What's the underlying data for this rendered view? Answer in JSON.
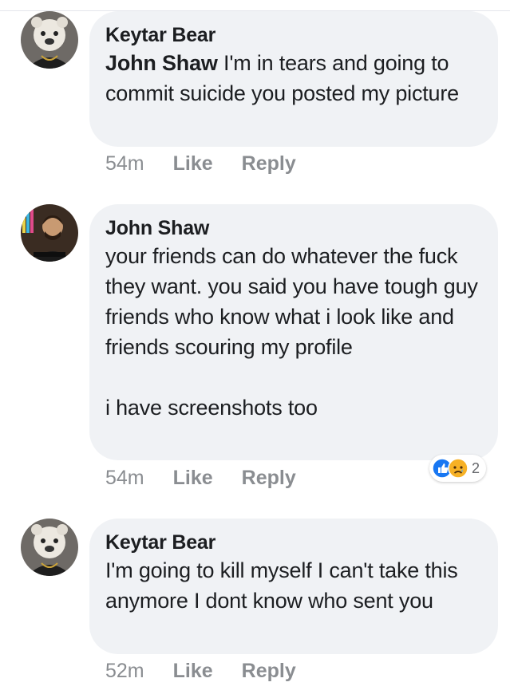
{
  "comments": [
    {
      "author": "Keytar Bear",
      "mention": "John Shaw",
      "text": "I'm in tears and going to commit suicide you posted my picture",
      "time": "54m",
      "like": "Like",
      "reply": "Reply"
    },
    {
      "author": "John Shaw",
      "text": "your friends can do whatever the fuck they want. you said you have tough guy friends who know what i look like and friends scouring my profile",
      "text2": "i have screenshots too",
      "time": "54m",
      "like": "Like",
      "reply": "Reply",
      "reactions": {
        "icons": [
          "like-reaction-icon",
          "sad-reaction-icon"
        ],
        "count": "2"
      }
    },
    {
      "author": "Keytar Bear",
      "text": "I'm going to kill myself I can't take this anymore I dont know who sent you",
      "time": "52m",
      "like": "Like",
      "reply": "Reply"
    }
  ],
  "colors": {
    "bubble": "#f0f2f5",
    "meta": "#8a8d91",
    "like_blue": "#1877f2",
    "sad_yellow": "#f7b125"
  }
}
